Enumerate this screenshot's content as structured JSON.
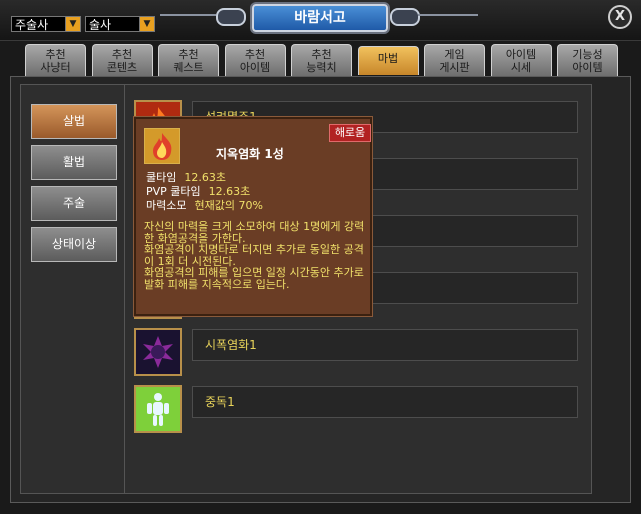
{
  "window": {
    "title": "바람서고",
    "close_label": "X"
  },
  "filters": {
    "job": "주술사",
    "sub": "술사"
  },
  "tabs": [
    {
      "label": "추천\n사냥터",
      "active": false
    },
    {
      "label": "추천\n콘텐츠",
      "active": false
    },
    {
      "label": "추천\n퀘스트",
      "active": false
    },
    {
      "label": "추천\n아이템",
      "active": false
    },
    {
      "label": "추천\n능력치",
      "active": false
    },
    {
      "label": "마법",
      "active": true
    },
    {
      "label": "게임\n게시판",
      "active": false
    },
    {
      "label": "아이템\n시세",
      "active": false
    },
    {
      "label": "기능성\n아이템",
      "active": false
    }
  ],
  "categories": [
    {
      "label": "살법",
      "active": true
    },
    {
      "label": "활법",
      "active": false
    },
    {
      "label": "주술",
      "active": false
    },
    {
      "label": "상태이상",
      "active": false
    }
  ],
  "skills": [
    {
      "name": "성려멸주1",
      "icon": "fire-skill-icon"
    },
    {
      "name": "지옥염화1",
      "icon": "fire-skill-icon"
    },
    {
      "name": "",
      "icon": "fire-skill-icon"
    },
    {
      "name": "",
      "icon": "fire-skill-icon"
    },
    {
      "name": "시폭염화1",
      "icon": "dark-orb-icon"
    },
    {
      "name": "중독1",
      "icon": "body-glow-icon"
    }
  ],
  "tooltip": {
    "title": "지옥염화 1성",
    "button": "해로움",
    "cooldown_label": "쿨타임",
    "cooldown_value": "12.63초",
    "pvp_label": "PVP 쿨타임",
    "pvp_value": "12.63초",
    "mana_label": "마력소모",
    "mana_value": "현재값의 70%",
    "description": "자신의 마력을 크게 소모하여 대상 1명에게 강력한 화염공격을 가한다.\n화염공격이 치명타로 터지면 추가로 동일한 공격이 1회 더 시전된다.\n화염공격의 피해를 입으면 일정 시간동안 추가로 발화 피해를 지속적으로 입는다."
  },
  "colors": {
    "accent_tab": "#e0a040",
    "skill_name": "#e8d35a",
    "tooltip_bg": "#6a3d25",
    "harm_badge": "#b22222"
  }
}
